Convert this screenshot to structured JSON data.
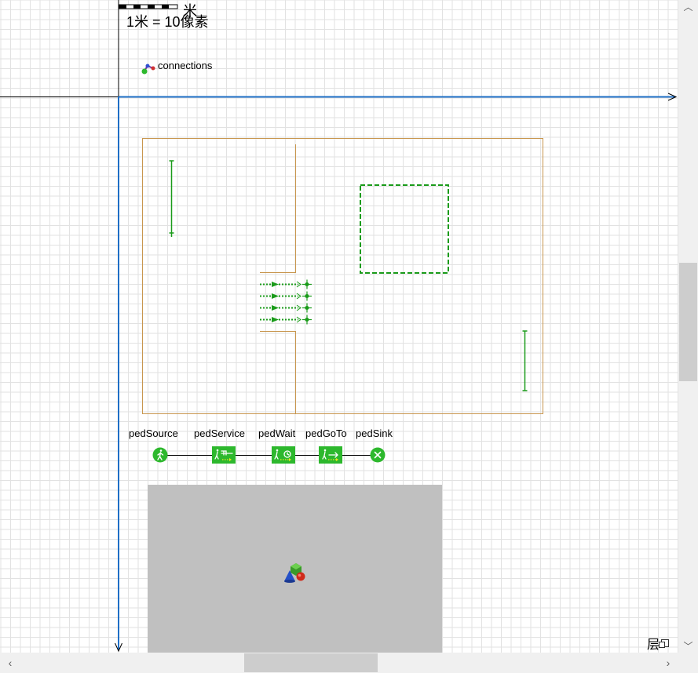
{
  "scale": {
    "label": "1米 = 10像素",
    "unit": "米"
  },
  "connections": {
    "label": "connections"
  },
  "blocks": [
    {
      "id": "pedSource",
      "label": "pedSource"
    },
    {
      "id": "pedService",
      "label": "pedService"
    },
    {
      "id": "pedWait",
      "label": "pedWait"
    },
    {
      "id": "pedGoTo",
      "label": "pedGoTo"
    },
    {
      "id": "pedSink",
      "label": "pedSink"
    }
  ],
  "layers": {
    "label": "层"
  },
  "colors": {
    "wall": "#c8964e",
    "green": "#1a9b1a",
    "block_green": "#2db82d",
    "axis": "#1f6fc6",
    "view3d": "#c0c0c0"
  }
}
